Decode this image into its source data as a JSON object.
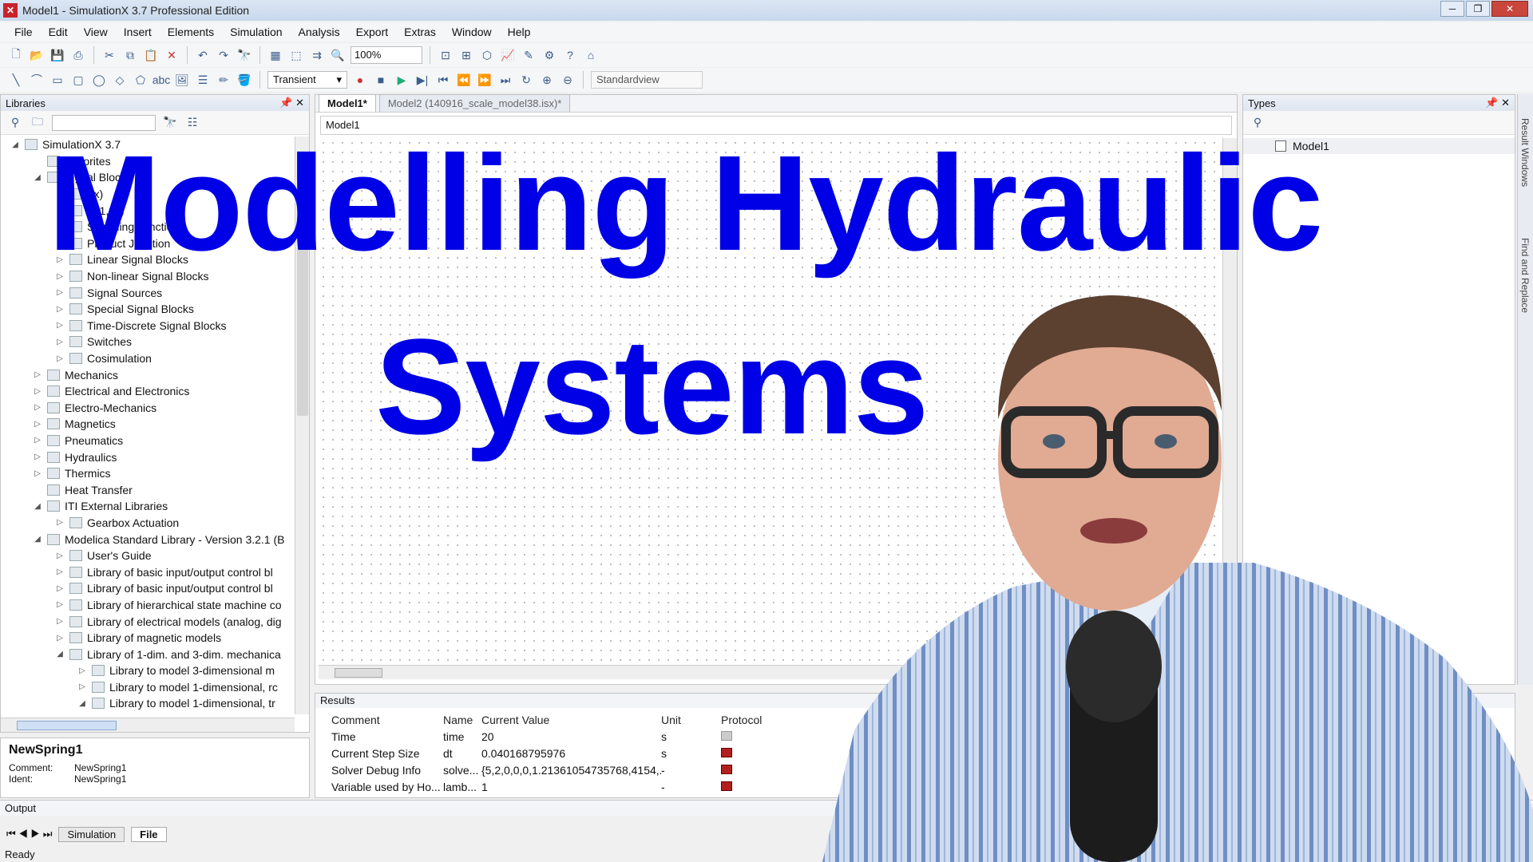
{
  "window": {
    "title": "Model1 - SimulationX 3.7 Professional Edition"
  },
  "menu": [
    "File",
    "Edit",
    "View",
    "Insert",
    "Elements",
    "Simulation",
    "Analysis",
    "Export",
    "Extras",
    "Window",
    "Help"
  ],
  "toolbar": {
    "zoom": "100%",
    "mode": "Transient",
    "view": "Standardview"
  },
  "libraries": {
    "title": "Libraries",
    "tree": [
      {
        "label": "SimulationX 3.7",
        "depth": 0,
        "exp": "◢"
      },
      {
        "label": "Favorites",
        "depth": 1,
        "exp": ""
      },
      {
        "label": "Signal Blocks",
        "depth": 1,
        "exp": "◢"
      },
      {
        "label": "f(x)",
        "depth": 2,
        "exp": ""
      },
      {
        "label": "f(x1,x2)",
        "depth": 2,
        "exp": ""
      },
      {
        "label": "Summing Junction",
        "depth": 2,
        "exp": ""
      },
      {
        "label": "Product Junction",
        "depth": 2,
        "exp": ""
      },
      {
        "label": "Linear Signal Blocks",
        "depth": 2,
        "exp": "▷"
      },
      {
        "label": "Non-linear Signal Blocks",
        "depth": 2,
        "exp": "▷"
      },
      {
        "label": "Signal Sources",
        "depth": 2,
        "exp": "▷"
      },
      {
        "label": "Special Signal Blocks",
        "depth": 2,
        "exp": "▷"
      },
      {
        "label": "Time-Discrete Signal Blocks",
        "depth": 2,
        "exp": "▷"
      },
      {
        "label": "Switches",
        "depth": 2,
        "exp": "▷"
      },
      {
        "label": "Cosimulation",
        "depth": 2,
        "exp": "▷"
      },
      {
        "label": "Mechanics",
        "depth": 1,
        "exp": "▷"
      },
      {
        "label": "Electrical and Electronics",
        "depth": 1,
        "exp": "▷"
      },
      {
        "label": "Electro-Mechanics",
        "depth": 1,
        "exp": "▷"
      },
      {
        "label": "Magnetics",
        "depth": 1,
        "exp": "▷"
      },
      {
        "label": "Pneumatics",
        "depth": 1,
        "exp": "▷"
      },
      {
        "label": "Hydraulics",
        "depth": 1,
        "exp": "▷"
      },
      {
        "label": "Thermics",
        "depth": 1,
        "exp": "▷"
      },
      {
        "label": "Heat Transfer",
        "depth": 1,
        "exp": ""
      },
      {
        "label": "ITI External Libraries",
        "depth": 1,
        "exp": "◢"
      },
      {
        "label": "Gearbox Actuation",
        "depth": 2,
        "exp": "▷"
      },
      {
        "label": "Modelica Standard Library - Version 3.2.1 (B",
        "depth": 1,
        "exp": "◢"
      },
      {
        "label": "User's Guide",
        "depth": 2,
        "exp": "▷"
      },
      {
        "label": "Library of basic input/output control bl",
        "depth": 2,
        "exp": "▷"
      },
      {
        "label": "Library of basic input/output control bl",
        "depth": 2,
        "exp": "▷"
      },
      {
        "label": "Library of hierarchical state machine co",
        "depth": 2,
        "exp": "▷"
      },
      {
        "label": "Library of electrical models (analog, dig",
        "depth": 2,
        "exp": "▷"
      },
      {
        "label": "Library of magnetic models",
        "depth": 2,
        "exp": "▷"
      },
      {
        "label": "Library of 1-dim. and 3-dim. mechanica",
        "depth": 2,
        "exp": "◢"
      },
      {
        "label": "Library to model 3-dimensional m",
        "depth": 3,
        "exp": "▷"
      },
      {
        "label": "Library to model 1-dimensional, rc",
        "depth": 3,
        "exp": "▷"
      },
      {
        "label": "Library to model 1-dimensional, tr",
        "depth": 3,
        "exp": "◢"
      }
    ]
  },
  "properties": {
    "name": "NewSpring1",
    "comment_label": "Comment:",
    "comment": "NewSpring1",
    "ident_label": "Ident:",
    "ident": "NewSpring1"
  },
  "model": {
    "tabs": [
      "Model1*",
      "Model2 (140916_scale_model38.isx)*"
    ],
    "breadcrumb": "Model1"
  },
  "types": {
    "title": "Types",
    "item": "Model1"
  },
  "sidetabs": [
    "Result Windows",
    "Find and Replace"
  ],
  "results": {
    "title": "Results",
    "columns": [
      "Comment",
      "Name",
      "Current Value",
      "Unit",
      "Protocol"
    ],
    "rows": [
      [
        "Time",
        "time",
        "20",
        "s"
      ],
      [
        "Current Step Size",
        "dt",
        "0.040168795976",
        "s"
      ],
      [
        "Solver Debug Info",
        "solve...",
        "{5,2,0,0,0,1.21361054735768,4154,...",
        "-"
      ],
      [
        "Variable used by Ho...",
        "lamb...",
        "1",
        "-"
      ]
    ]
  },
  "output": {
    "title": "Output"
  },
  "bottom_tabs": [
    "Simulation",
    "File"
  ],
  "status": "Ready",
  "overlay": {
    "line1": "Modelling Hydraulic",
    "line2": "Systems"
  },
  "colors": {
    "headline": "#0000e6",
    "accent": "#3b5d8c"
  }
}
